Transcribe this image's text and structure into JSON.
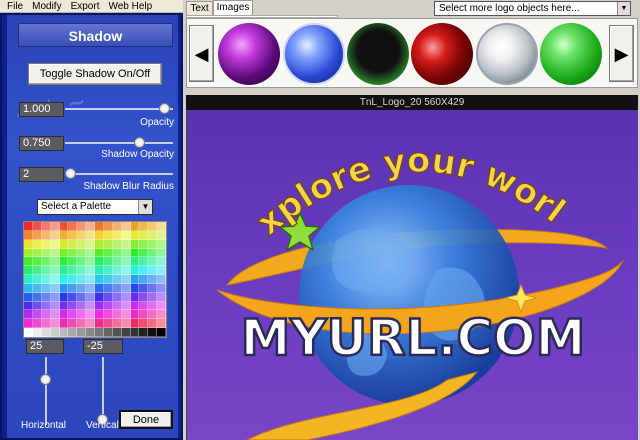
{
  "menu": {
    "items": [
      "File",
      "Modify",
      "Export",
      "Web Help"
    ]
  },
  "shadow_panel": {
    "title": "Shadow",
    "toggle_button": "Toggle Shadow On/Off",
    "opacity": {
      "value": "1.000",
      "label": "Opacity",
      "level": 1.0
    },
    "shadow_opacity": {
      "value": "0.750",
      "label": "Shadow Opacity",
      "level": 0.75
    },
    "shadow_blur_radius": {
      "value": "2",
      "label": "Shadow Blur Radius",
      "level": 0.0
    },
    "palette_select": {
      "selected": "Select a Palette"
    },
    "horizontal": {
      "value": "25",
      "label": "Horizontal"
    },
    "vertical": {
      "value": "-25",
      "label": "Vertical"
    },
    "done_button": "Done"
  },
  "tabs": [
    {
      "label": "Text",
      "active": false
    },
    {
      "label": "Images",
      "active": true
    }
  ],
  "logo_select": {
    "selected": "Select more logo objects here..."
  },
  "thumbnails": {
    "prev_icon": "◀",
    "next_icon": "▶",
    "items": [
      "purple-orb",
      "blue-orb",
      "black-green-orb",
      "red-orb",
      "silver-orb",
      "green-orb"
    ]
  },
  "canvas": {
    "title": "TnL_Logo_20 560X429",
    "logo": {
      "headline": "explore your world",
      "url_text": "MYURL.COM"
    }
  },
  "colors": {
    "panel_bg": "#2c46bd",
    "canvas_bg": "#6a3cc0",
    "headline_yellow": "#f3d54a",
    "ribbon_orange": "#f4a51c",
    "globe_blue": "#2a6bd6"
  }
}
